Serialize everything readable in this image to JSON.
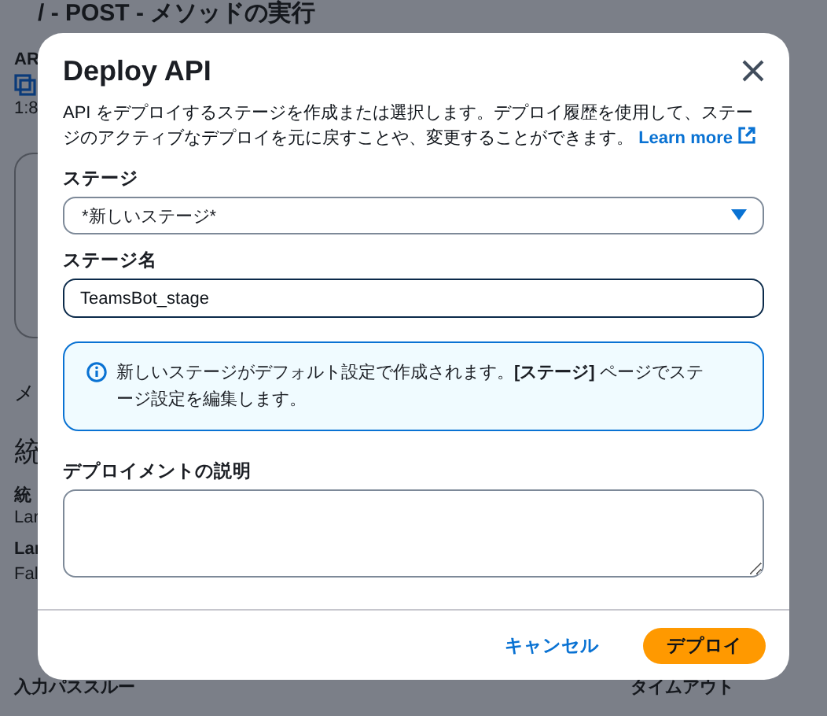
{
  "background": {
    "page_title": "/ - POST - メソッドの実行",
    "left_column": [
      {
        "kind": "label",
        "text": "AR"
      },
      {
        "kind": "icon"
      },
      {
        "kind": "value",
        "text": "1:8"
      },
      {
        "kind": "card"
      },
      {
        "kind": "tab",
        "text": "メ"
      },
      {
        "kind": "heading",
        "text": "統"
      },
      {
        "kind": "label",
        "text": "統"
      },
      {
        "kind": "value",
        "text": "Lar"
      },
      {
        "kind": "label",
        "text": "Lar"
      },
      {
        "kind": "value",
        "text": "Fal"
      }
    ],
    "bottom_labels": [
      "入力パススルー",
      "タイムアウト"
    ]
  },
  "modal": {
    "title": "Deploy API",
    "description": "API をデプロイするステージを作成または選択します。デプロイ履歴を使用して、ステージのアクティブなデプロイを元に戻すことや、変更することができます。",
    "learn_more": "Learn more",
    "stage": {
      "label": "ステージ",
      "value": "*新しいステージ*"
    },
    "stage_name": {
      "label": "ステージ名",
      "value": "TeamsBot_stage"
    },
    "info": "新しいステージがデフォルト設定で作成されます。**[ステージ]** ページでステージ設定を編集します。",
    "description_field": {
      "label": "デプロイメントの説明"
    },
    "buttons": [
      {
        "kind": "link",
        "label": "キャンセル"
      },
      {
        "kind": "primary",
        "label": "デプロイ"
      }
    ]
  }
}
